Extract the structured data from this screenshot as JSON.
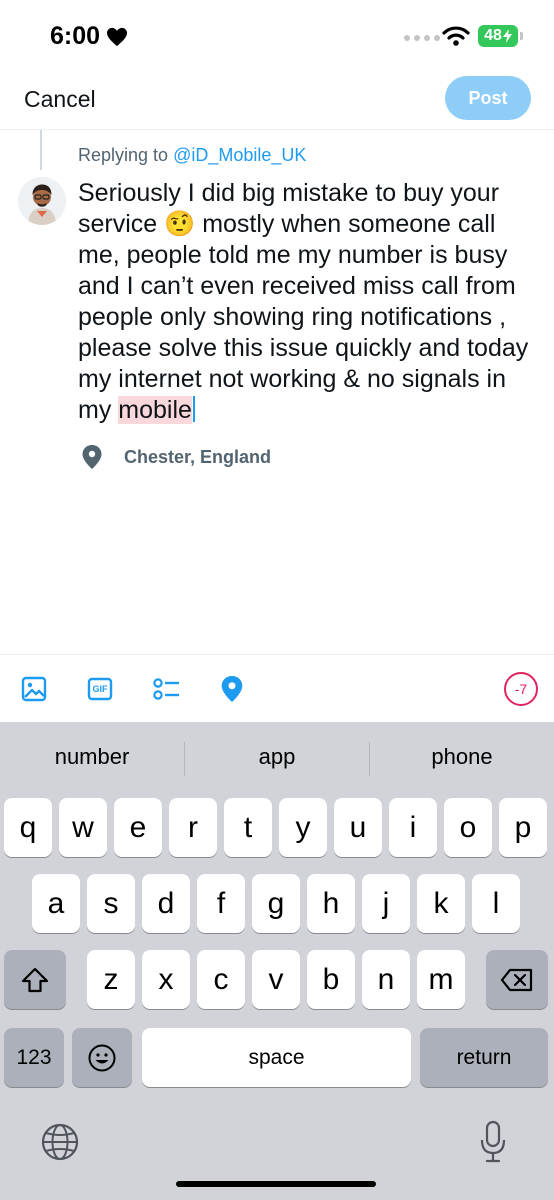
{
  "status_bar": {
    "time": "6:00",
    "battery": "48"
  },
  "header": {
    "cancel_label": "Cancel",
    "post_label": "Post"
  },
  "compose": {
    "replying_prefix": "Replying to ",
    "replying_handle": "@iD_Mobile_UK",
    "text_before": "Seriously I did big mistake to buy your service 🤨 mostly when someone call me, people told me my number is busy and I can’t even received miss call from people only showing ring notifications , please solve this issue quickly and today my internet not working & no signals in my ",
    "text_highlight": "mobile",
    "location": "Chester, England"
  },
  "toolbar": {
    "icons": [
      "image-icon",
      "gif-icon",
      "poll-icon",
      "location-icon"
    ],
    "gif_label": "GIF",
    "char_counter": "-7",
    "accent_color": "#1d9bf0",
    "over_limit_color": "#e0245e"
  },
  "keyboard": {
    "suggestions": [
      "number",
      "app",
      "phone"
    ],
    "row1": [
      "q",
      "w",
      "e",
      "r",
      "t",
      "y",
      "u",
      "i",
      "o",
      "p"
    ],
    "row2": [
      "a",
      "s",
      "d",
      "f",
      "g",
      "h",
      "j",
      "k",
      "l"
    ],
    "row3": [
      "z",
      "x",
      "c",
      "v",
      "b",
      "n",
      "m"
    ],
    "numbers_label": "123",
    "space_label": "space",
    "return_label": "return"
  }
}
